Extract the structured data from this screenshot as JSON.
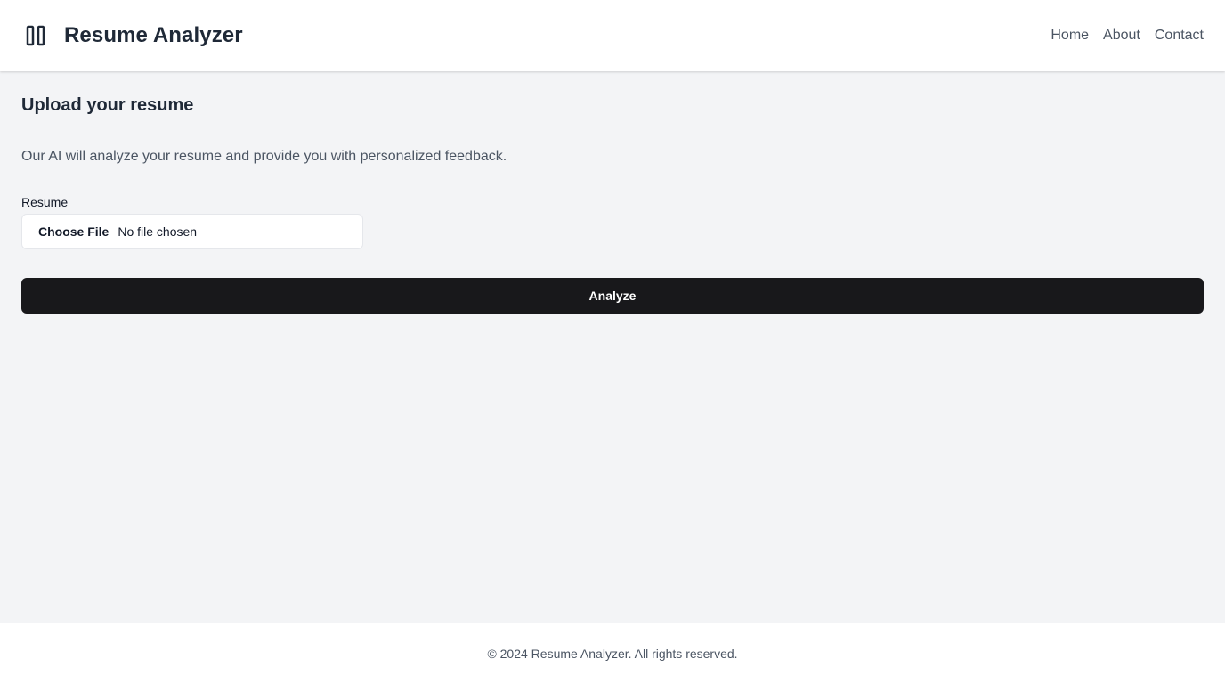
{
  "header": {
    "logo_icon": "columns-icon",
    "title": "Resume Analyzer",
    "nav": [
      {
        "label": "Home"
      },
      {
        "label": "About"
      },
      {
        "label": "Contact"
      }
    ]
  },
  "main": {
    "title": "Upload your resume",
    "description": "Our AI will analyze your resume and provide you with personalized feedback.",
    "resume_field": {
      "label": "Resume",
      "button_label": "Choose File",
      "status": "No file chosen"
    },
    "analyze_label": "Analyze"
  },
  "footer": {
    "text": "© 2024 Resume Analyzer. All rights reserved."
  },
  "colors": {
    "background": "#f3f4f6",
    "surface": "#ffffff",
    "primary_button": "#18181b",
    "text_primary": "#1f2937",
    "text_secondary": "#4b5563"
  }
}
